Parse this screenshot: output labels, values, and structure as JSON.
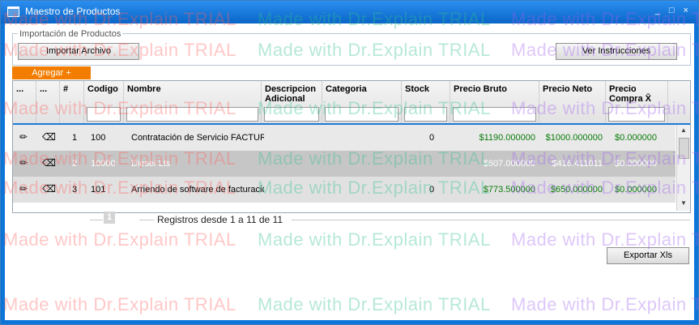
{
  "window": {
    "title": "Maestro de Productos",
    "controls": "_ □ ×"
  },
  "import": {
    "legend": "Importación de Productos",
    "import_btn": "Importar Archivo",
    "instructions_btn": "Ver Instrucciones"
  },
  "add_btn": "Agregar +",
  "columns": [
    "...",
    "...",
    "#",
    "Codigo",
    "Nombre",
    "Descripcion Adicional",
    "Categoria",
    "Stock",
    "Precio Bruto",
    "Precio Neto",
    "Precio Compra X̄"
  ],
  "rows": [
    {
      "num": "1",
      "codigo": "100",
      "nombre": "Contratación de Servicio FACTURA",
      "desc": "",
      "cat": "",
      "stock": "0",
      "bruto": "$1190.000000",
      "neto": "$1000.000000",
      "compra": "$0.000000"
    },
    {
      "num": "2",
      "codigo": "10000",
      "nombre": "Diesel Lts",
      "desc": "",
      "cat": "",
      "stock": "",
      "bruto": "$607.000000",
      "neto": "$416.411011",
      "compra": "$0.000000"
    },
    {
      "num": "3",
      "codigo": "101",
      "nombre": "Arriendo de software de facturació",
      "desc": "",
      "cat": "",
      "stock": "0",
      "bruto": "$773.500000",
      "neto": "$650.000000",
      "compra": "$0.000000"
    }
  ],
  "pager": {
    "page": "1",
    "text": "Registros desde 1 a 11 de 11"
  },
  "export_btn": "Exportar Xls",
  "watermark": "Made with Dr.Explain TRIAL"
}
